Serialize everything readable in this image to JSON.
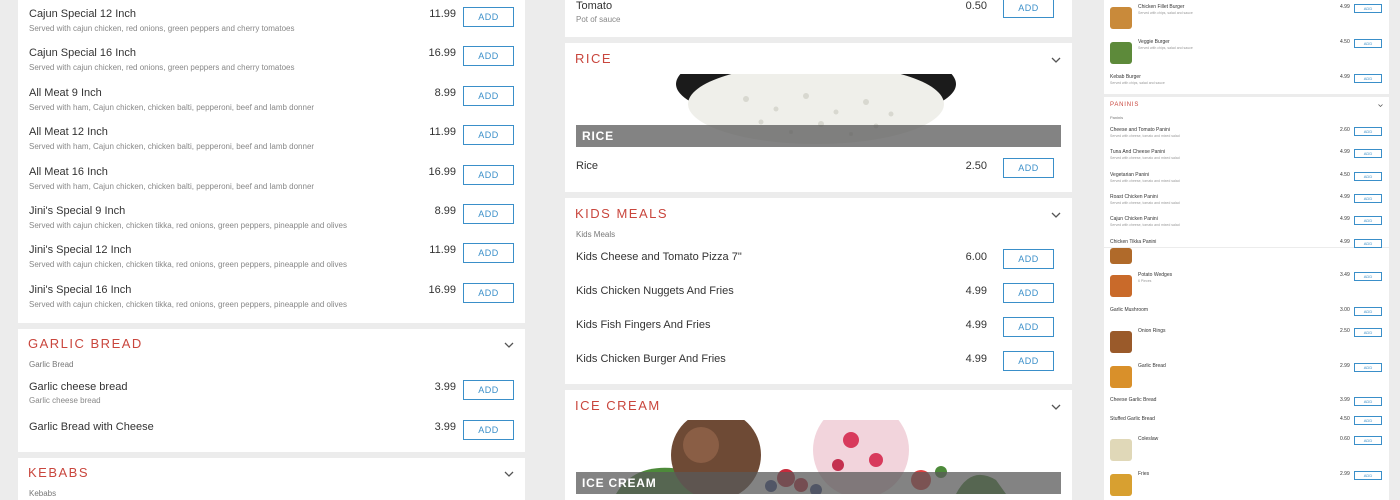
{
  "add_label": "ADD",
  "colors": {
    "accent": "#3a8fc9",
    "section_title": "#c9463d"
  },
  "panel1": {
    "items": [
      {
        "name": "Cajun Special 12 Inch",
        "desc": "Served with cajun chicken, red onions, green peppers and cherry tomatoes",
        "price": "11.99"
      },
      {
        "name": "Cajun Special 16 Inch",
        "desc": "Served with cajun chicken, red onions, green peppers and cherry tomatoes",
        "price": "16.99"
      },
      {
        "name": "All Meat 9 Inch",
        "desc": "Served with ham, Cajun chicken, chicken balti, pepperoni, beef and lamb donner",
        "price": "8.99"
      },
      {
        "name": "All Meat 12 Inch",
        "desc": "Served with ham, Cajun chicken, chicken balti, pepperoni, beef and lamb donner",
        "price": "11.99"
      },
      {
        "name": "All Meat 16 Inch",
        "desc": "Served with ham, Cajun chicken, chicken balti, pepperoni, beef and lamb donner",
        "price": "16.99"
      },
      {
        "name": "Jini's Special 9 Inch",
        "desc": "Served with cajun chicken, chicken tikka, red onions, green peppers, pineapple and olives",
        "price": "8.99"
      },
      {
        "name": "Jini's Special 12 Inch",
        "desc": "Served with cajun chicken, chicken tikka, red onions, green peppers, pineapple and olives",
        "price": "11.99"
      },
      {
        "name": "Jini's Special 16 Inch",
        "desc": "Served with cajun chicken, chicken tikka, red onions, green peppers, pineapple and olives",
        "price": "16.99"
      }
    ],
    "garlic_bread": {
      "title": "GARLIC BREAD",
      "subtitle": "Garlic Bread",
      "items": [
        {
          "name": "Garlic cheese bread",
          "desc": "Garlic cheese bread",
          "price": "3.99"
        },
        {
          "name": "Garlic Bread with Cheese",
          "desc": "",
          "price": "3.99"
        }
      ]
    },
    "kebabs": {
      "title": "KEBABS",
      "subtitle": "Kebabs"
    }
  },
  "panel2": {
    "tomato": {
      "name": "Tomato",
      "desc": "Pot of sauce",
      "price": "0.50"
    },
    "rice": {
      "title": "RICE",
      "banner": "RICE",
      "items": [
        {
          "name": "Rice",
          "price": "2.50"
        }
      ]
    },
    "kids": {
      "title": "KIDS MEALS",
      "subtitle": "Kids Meals",
      "items": [
        {
          "name": "Kids Cheese and Tomato Pizza 7\"",
          "price": "6.00"
        },
        {
          "name": "Kids Chicken Nuggets And Fries",
          "price": "4.99"
        },
        {
          "name": "Kids Fish Fingers And Fries",
          "price": "4.99"
        },
        {
          "name": "Kids Chicken Burger And Fries",
          "price": "4.99"
        }
      ]
    },
    "icecream": {
      "title": "ICE CREAM",
      "banner": "ICE CREAM"
    }
  },
  "panel3": {
    "burgers": [
      {
        "name": "Chicken Fillet Burger",
        "desc": "Served with chips, salad and sauce",
        "price": "4.99"
      },
      {
        "name": "Veggie Burger",
        "desc": "Served with chips, salad and sauce",
        "price": "4.50"
      },
      {
        "name": "Kebab Burger",
        "desc": "Served with chips, salad and sauce",
        "price": "4.99"
      }
    ],
    "paninis": {
      "title": "PANINIS",
      "subtitle": "Paninis",
      "items": [
        {
          "name": "Cheese and Tomato Panini",
          "desc": "Served with cheese, tomato and mixed salad",
          "price": "2.60"
        },
        {
          "name": "Tuna And Cheese Panini",
          "desc": "Served with cheese, tomato and mixed salad",
          "price": "4.99"
        },
        {
          "name": "Vegetarian Panini",
          "desc": "Served with cheese, tomato and mixed salad",
          "price": "4.50"
        },
        {
          "name": "Roast Chicken Panini",
          "desc": "Served with cheese, tomato and mixed salad",
          "price": "4.99"
        },
        {
          "name": "Cajun Chicken Panini",
          "desc": "Served with cheese, tomato and mixed salad",
          "price": "4.99"
        },
        {
          "name": "Chicken Tikka Panini",
          "desc": "",
          "price": "4.99"
        }
      ]
    },
    "sides": [
      {
        "name": "Potato Wedges",
        "desc": "6 Pieces",
        "price": "3.49",
        "thumb": true
      },
      {
        "name": "Garlic Mushroom",
        "desc": "",
        "price": "3.00",
        "thumb": false
      },
      {
        "name": "Onion Rings",
        "desc": "",
        "price": "2.50",
        "thumb": true
      },
      {
        "name": "Garlic Bread",
        "desc": "",
        "price": "2.99",
        "thumb": true
      },
      {
        "name": "Cheese Garlic Bread",
        "desc": "",
        "price": "3.99",
        "thumb": false
      },
      {
        "name": "Stuffed Garlic Bread",
        "desc": "",
        "price": "4.50",
        "thumb": false
      },
      {
        "name": "Coleslaw",
        "desc": "",
        "price": "0.60",
        "thumb": true
      },
      {
        "name": "Fries",
        "desc": "",
        "price": "2.99",
        "thumb": true
      }
    ]
  }
}
